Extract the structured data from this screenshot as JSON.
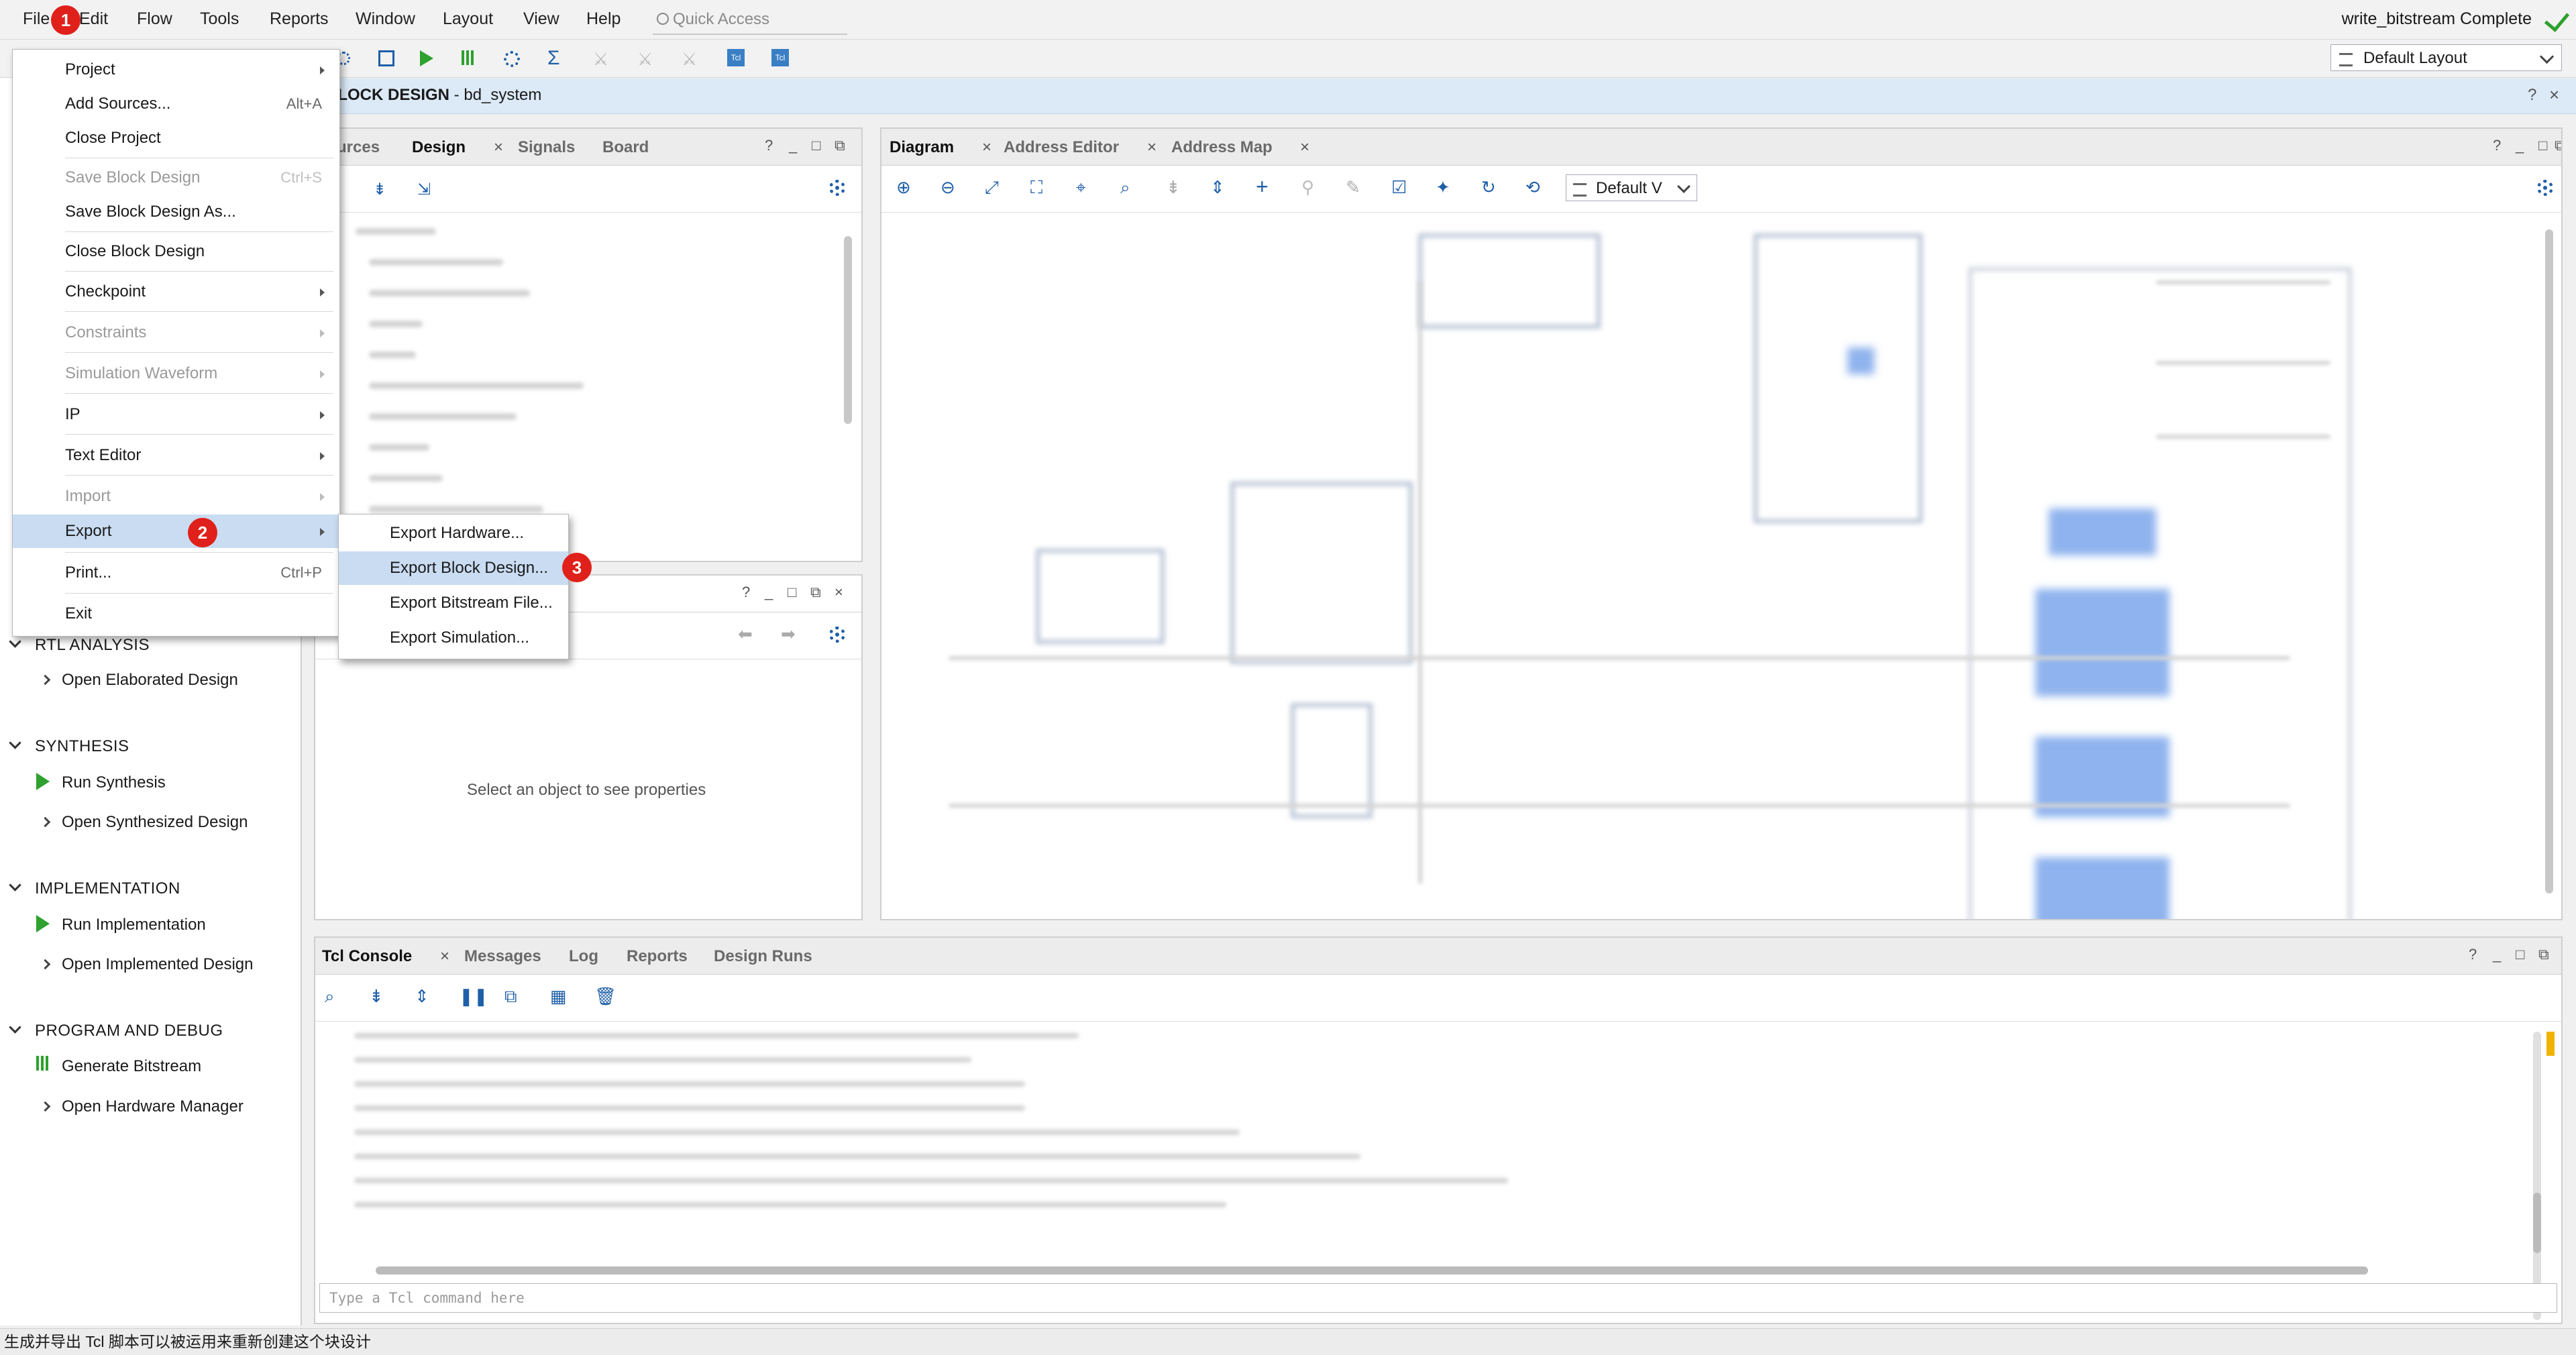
{
  "menubar": {
    "items": [
      "File",
      "Edit",
      "Flow",
      "Tools",
      "Reports",
      "Window",
      "Layout",
      "View",
      "Help"
    ],
    "quick_access_placeholder": "Quick Access",
    "status": "write_bitstream Complete"
  },
  "toolbar": {
    "layout_select": "Default Layout"
  },
  "block_design": {
    "title_bold": "BLOCK DESIGN",
    "title_rest": " - bd_system"
  },
  "left_nav": {
    "sections": [
      {
        "title": "RTL ANALYSIS",
        "items": [
          "Open Elaborated Design"
        ]
      },
      {
        "title": "SYNTHESIS",
        "items": [
          "Run Synthesis",
          "Open Synthesized Design"
        ]
      },
      {
        "title": "IMPLEMENTATION",
        "items": [
          "Run Implementation",
          "Open Implemented Design"
        ]
      },
      {
        "title": "PROGRAM AND DEBUG",
        "items": [
          "Generate Bitstream",
          "Open Hardware Manager"
        ]
      }
    ]
  },
  "sources_panel": {
    "tabs": [
      "urces",
      "Design",
      "Signals",
      "Board"
    ],
    "close": "×",
    "ctrls": [
      "?",
      "_",
      "□",
      "⧉"
    ]
  },
  "properties_panel": {
    "empty_text": "Select an object to see properties",
    "ctrls": [
      "?",
      "_",
      "□",
      "⧉",
      "×"
    ]
  },
  "diagram_panel": {
    "tabs": [
      "Diagram",
      "Address Editor",
      "Address Map"
    ],
    "view_select": "Default V",
    "ctrls": [
      "?",
      "_",
      "□",
      "⧉"
    ]
  },
  "tcl_panel": {
    "tabs": [
      "Tcl Console",
      "Messages",
      "Log",
      "Reports",
      "Design Runs"
    ],
    "input_placeholder": "Type a Tcl command here",
    "ctrls": [
      "?",
      "_",
      "□",
      "⧉"
    ]
  },
  "file_menu": {
    "items": [
      {
        "label": "Project",
        "shortcut": "",
        "submenu": true,
        "disabled": false
      },
      {
        "label": "Add Sources...",
        "shortcut": "Alt+A",
        "submenu": false,
        "disabled": false
      },
      {
        "label": "Close Project",
        "shortcut": "",
        "submenu": false,
        "disabled": false
      },
      {
        "label": "Save Block Design",
        "shortcut": "Ctrl+S",
        "submenu": false,
        "disabled": true
      },
      {
        "label": "Save Block Design As...",
        "shortcut": "",
        "submenu": false,
        "disabled": false
      },
      {
        "label": "Close Block Design",
        "shortcut": "",
        "submenu": false,
        "disabled": false
      },
      {
        "label": "Checkpoint",
        "shortcut": "",
        "submenu": true,
        "disabled": false
      },
      {
        "label": "Constraints",
        "shortcut": "",
        "submenu": true,
        "disabled": true
      },
      {
        "label": "Simulation Waveform",
        "shortcut": "",
        "submenu": true,
        "disabled": true
      },
      {
        "label": "IP",
        "shortcut": "",
        "submenu": true,
        "disabled": false
      },
      {
        "label": "Text Editor",
        "shortcut": "",
        "submenu": true,
        "disabled": false
      },
      {
        "label": "Import",
        "shortcut": "",
        "submenu": true,
        "disabled": true
      },
      {
        "label": "Export",
        "shortcut": "",
        "submenu": true,
        "disabled": false
      },
      {
        "label": "Print...",
        "shortcut": "Ctrl+P",
        "submenu": false,
        "disabled": false
      },
      {
        "label": "Exit",
        "shortcut": "",
        "submenu": false,
        "disabled": false
      }
    ]
  },
  "export_submenu": {
    "items": [
      "Export Hardware...",
      "Export Block Design...",
      "Export Bitstream File...",
      "Export Simulation..."
    ]
  },
  "badges": [
    "1",
    "2",
    "3"
  ],
  "status_bar": {
    "text": "生成并导出 Tcl 脚本可以被运用来重新创建这个块设计"
  },
  "colors": {
    "accent": "#1f5fa8",
    "highlight": "#c9dcf2",
    "badge": "#e0201a",
    "success": "#2ea12e"
  }
}
